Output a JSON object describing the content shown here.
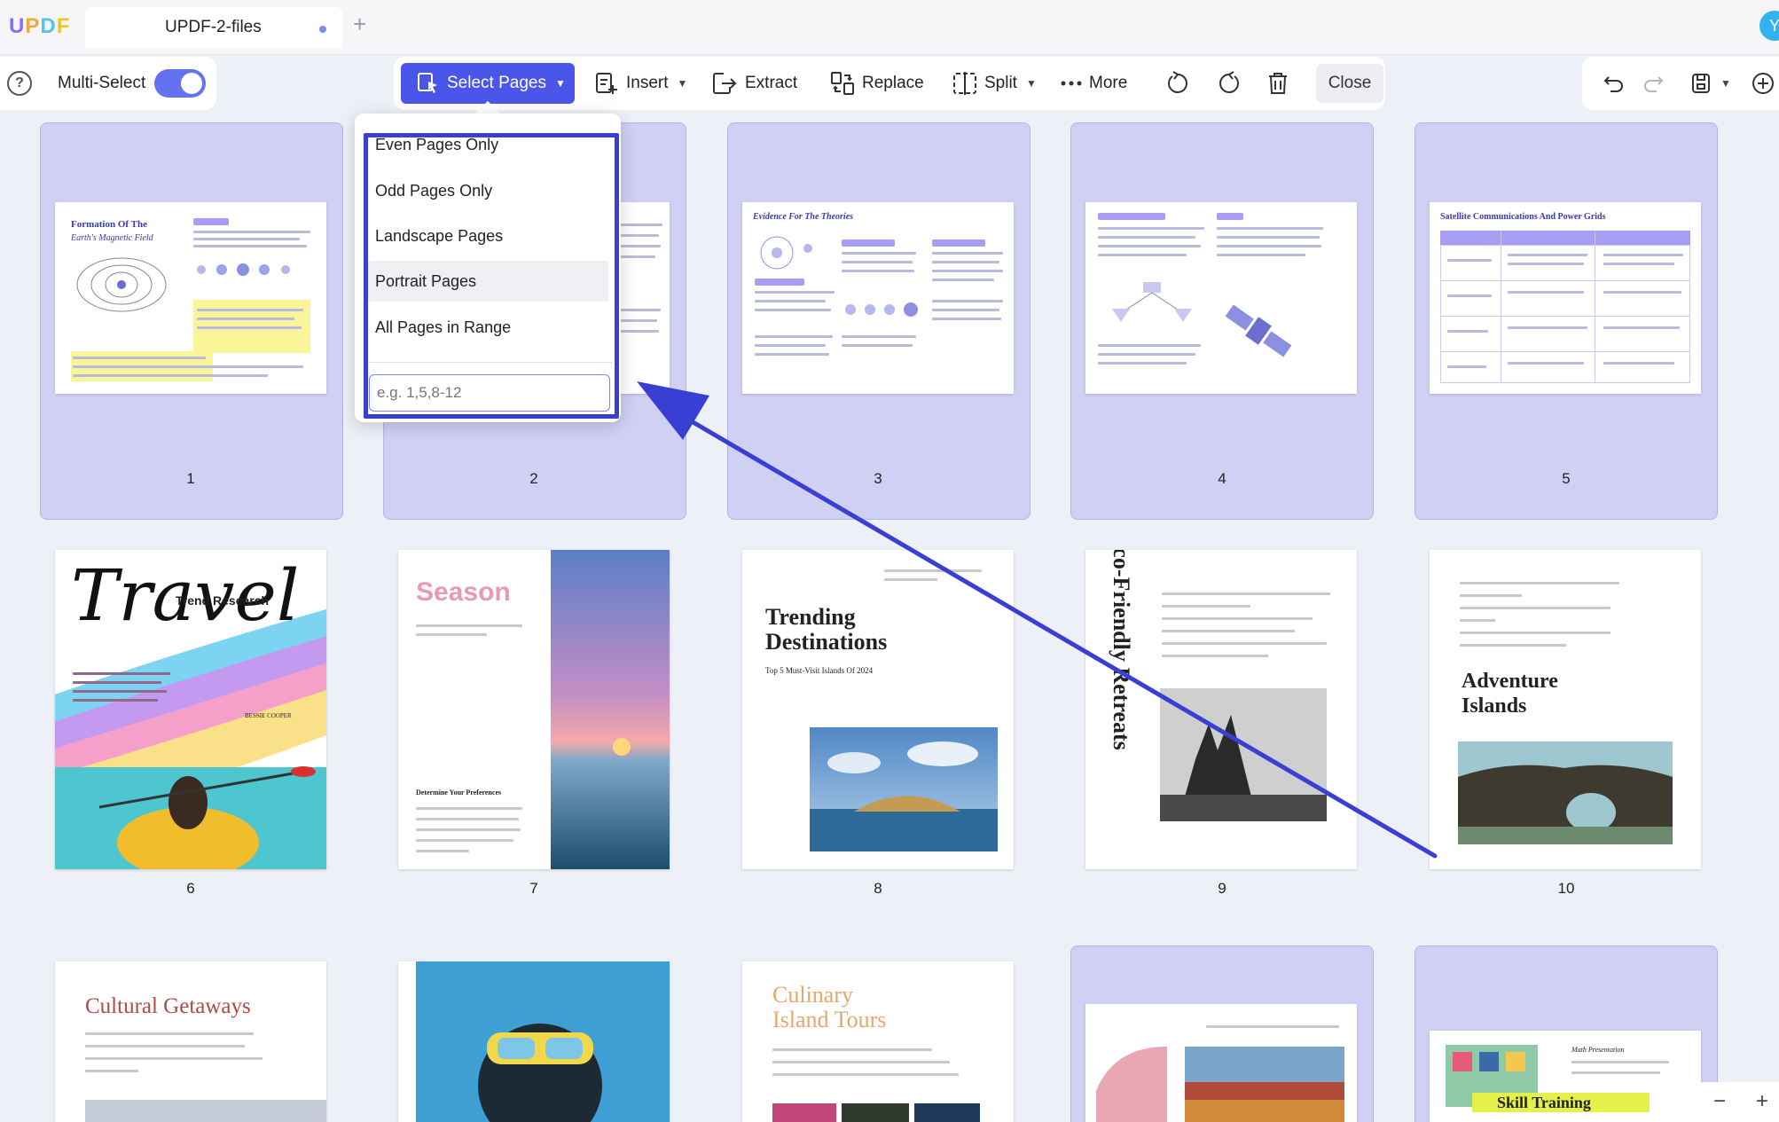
{
  "app": {
    "logo": {
      "l1": "U",
      "l2": "P",
      "l3": "D",
      "l4": "F"
    },
    "tab_title": "UPDF-2-files",
    "tab_add": "+",
    "avatar_initial": "Y"
  },
  "toolbar": {
    "multi_select_label": "Multi-Select",
    "multi_select_on": true,
    "select_pages": "Select Pages",
    "insert": "Insert",
    "extract": "Extract",
    "replace": "Replace",
    "split": "Split",
    "more": "More",
    "close": "Close",
    "accent_color": "#4a56ea"
  },
  "dropdown": {
    "items": [
      "Even Pages Only",
      "Odd Pages Only",
      "Landscape Pages",
      "Portrait Pages",
      "All Pages in Range"
    ],
    "hovered_item": "Portrait Pages",
    "range_placeholder": "e.g. 1,5,8-12"
  },
  "pages": [
    {
      "num": "1",
      "title1": "Formation Of The",
      "title2": "Earth's Magnetic Field",
      "selected": true
    },
    {
      "num": "2",
      "selected": true
    },
    {
      "num": "3",
      "title1": "Evidence For The Theories",
      "selected": true
    },
    {
      "num": "4",
      "selected": true
    },
    {
      "num": "5",
      "title1": "Satellite Communications And Power Grids",
      "selected": true
    },
    {
      "num": "6",
      "title1": "Travel",
      "title2": "Trend Research",
      "title3": "BESSIE COOPER",
      "selected": false
    },
    {
      "num": "7",
      "title1": "Season",
      "title2": "Determine Your Preferences",
      "selected": false
    },
    {
      "num": "8",
      "title1": "Trending",
      "title2": "Destinations",
      "title3": "Top 5 Must-Visit Islands Of 2024",
      "selected": false
    },
    {
      "num": "9",
      "title1": "Eco-Friendly Retreats",
      "selected": false
    },
    {
      "num": "10",
      "title1": "Adventure",
      "title2": "Islands",
      "selected": false
    },
    {
      "title1": "Cultural Getaways",
      "selected": false
    },
    {
      "selected": false
    },
    {
      "title1": "Culinary",
      "title2": "Island Tours",
      "selected": false
    },
    {
      "selected": true
    },
    {
      "title1": "Skill Training",
      "title2": "Math Presentation",
      "selected": true
    }
  ],
  "zoom": {
    "minus": "−",
    "plus": "+"
  }
}
